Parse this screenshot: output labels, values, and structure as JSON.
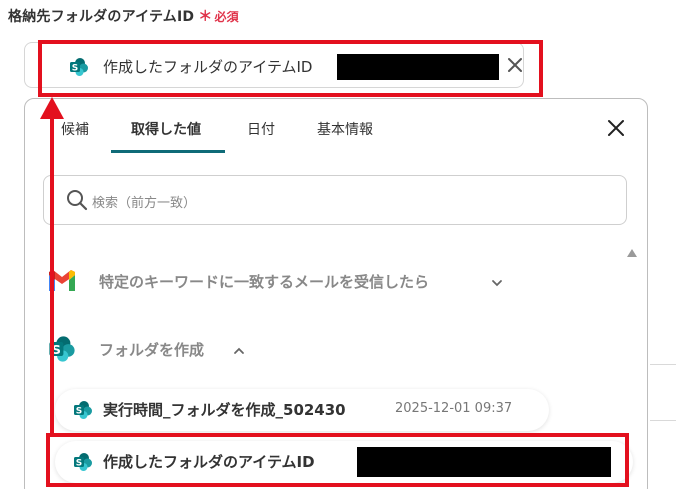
{
  "field": {
    "label": "格納先フォルダのアイテムID",
    "required_mark": "＊",
    "required_text": "必須"
  },
  "selected": {
    "value_label": "作成したフォルダのアイテムID",
    "clear_icon": "close-icon"
  },
  "popup": {
    "tabs": [
      {
        "label": "候補"
      },
      {
        "label": "取得した値"
      },
      {
        "label": "日付"
      },
      {
        "label": "基本情報"
      }
    ],
    "active_tab": "取得した値",
    "search_placeholder": "検索（前方一致）",
    "groups": [
      {
        "icon": "gmail-icon",
        "label": "特定のキーワードに一致するメールを受信したら",
        "expanded": false
      },
      {
        "icon": "sharepoint-icon",
        "label": "フォルダを作成",
        "expanded": true
      }
    ],
    "items": [
      {
        "icon": "sharepoint-icon",
        "label": "実行時間_フォルダを作成_502430",
        "time": "2025-12-01 09:37"
      },
      {
        "icon": "sharepoint-icon",
        "label": "作成したフォルダのアイテムID"
      }
    ]
  },
  "colors": {
    "accent": "#0f6b78",
    "annotation_red": "#e3101e",
    "required_red": "#e0334a",
    "sharepoint_teal": "#038387"
  }
}
